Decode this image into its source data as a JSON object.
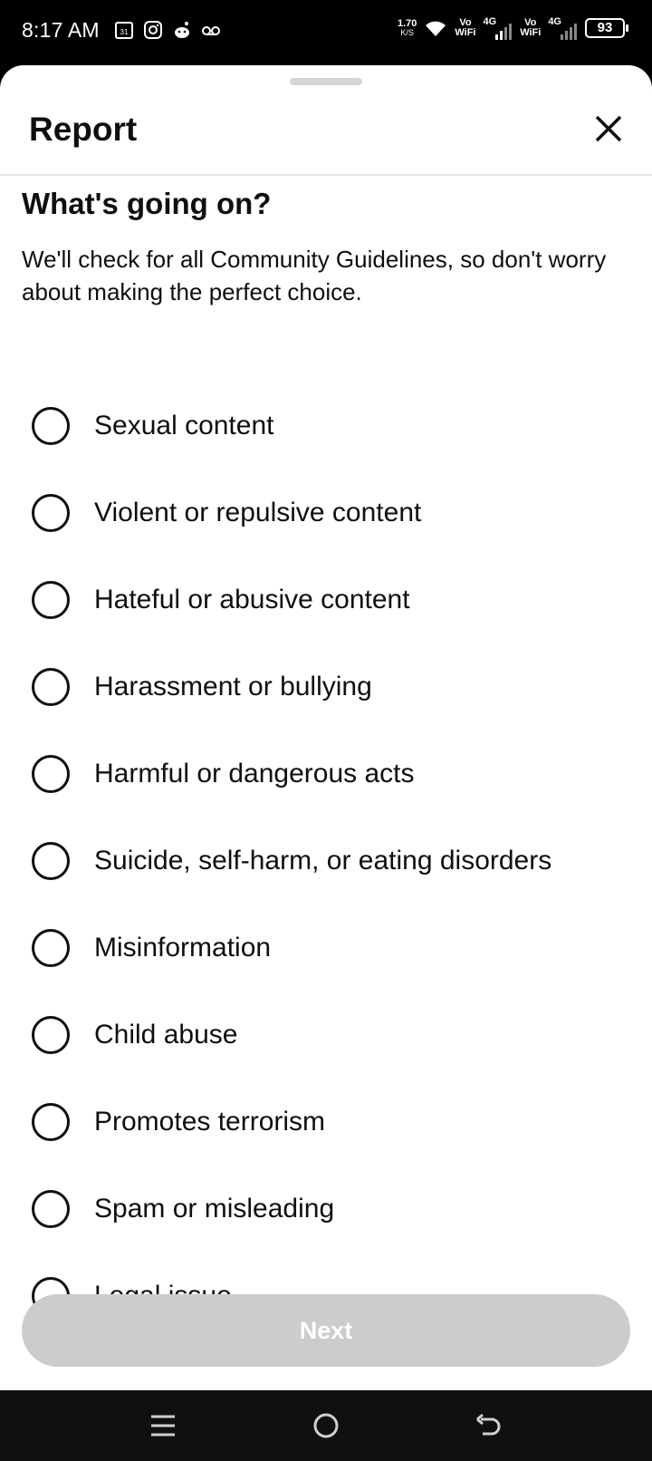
{
  "status_bar": {
    "time": "8:17 AM",
    "speed_value": "1.70",
    "speed_unit": "K/S",
    "vowifi_1": "Vo\nWiFi",
    "net_1": "4G",
    "vowifi_2": "Vo\nWiFi",
    "net_2": "4G",
    "battery": "93"
  },
  "sheet": {
    "title": "Report",
    "question": "What's going on?",
    "description": "We'll check for all Community Guidelines, so don't worry about making the perfect choice.",
    "options": [
      "Sexual content",
      "Violent or repulsive content",
      "Hateful or abusive content",
      "Harassment or bullying",
      "Harmful or dangerous acts",
      "Suicide, self-harm, or eating disorders",
      "Misinformation",
      "Child abuse",
      "Promotes terrorism",
      "Spam or misleading",
      "Legal issue"
    ],
    "next_label": "Next"
  },
  "colors": {
    "text": "#0f0f0f",
    "disabled_button": "#cccccc",
    "divider": "#e5e5e5"
  },
  "icons": {
    "status_left": [
      "calendar-icon",
      "instagram-icon",
      "reddit-icon",
      "voicemail-icon"
    ],
    "nav": [
      "menu-icon",
      "home-icon",
      "back-icon"
    ]
  }
}
